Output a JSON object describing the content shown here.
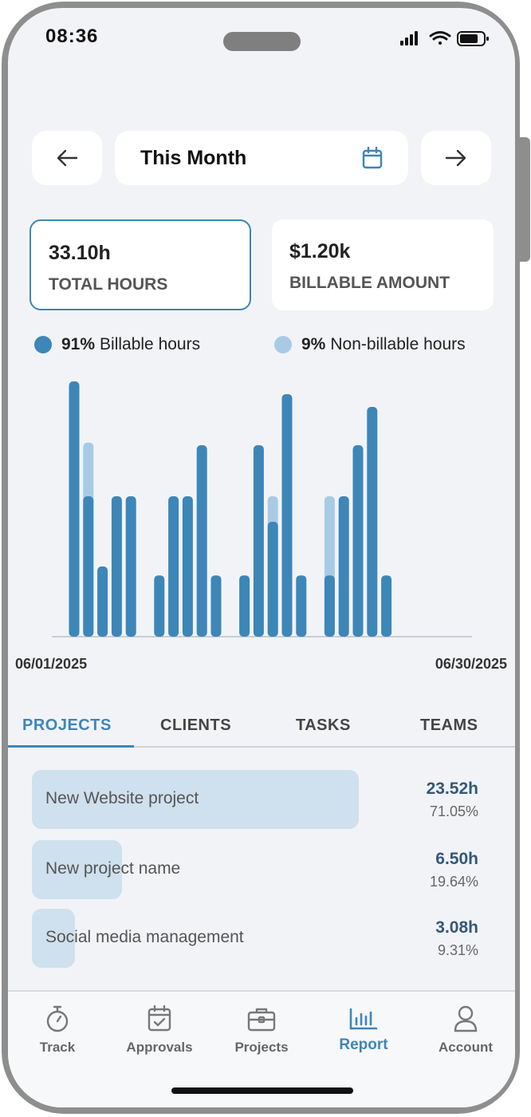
{
  "status_bar": {
    "time": "08:36"
  },
  "range_selector": {
    "label": "This Month"
  },
  "stats": [
    {
      "value": "33.10h",
      "label": "TOTAL HOURS",
      "selected": true
    },
    {
      "value": "$1.20k",
      "label": "BILLABLE AMOUNT",
      "selected": false
    }
  ],
  "legend": [
    {
      "percent": "91%",
      "label": "Billable hours",
      "color": "#3d86b8"
    },
    {
      "percent": "9%",
      "label": "Non-billable hours",
      "color": "#a8cbe5"
    }
  ],
  "chart_data": {
    "type": "bar",
    "stacked": true,
    "x_start_label": "06/01/2025",
    "x_end_label": "06/30/2025",
    "series": [
      {
        "name": "Billable hours",
        "color": "#3d86b8",
        "values": [
          2.0,
          1.1,
          0.55,
          1.1,
          1.1,
          0,
          0.48,
          1.1,
          1.1,
          1.5,
          0.48,
          0,
          0.48,
          1.5,
          0.9,
          1.9,
          0.48,
          0,
          0.48,
          1.1,
          1.5,
          1.8,
          0.48
        ]
      },
      {
        "name": "Non-billable hours",
        "color": "#a8cbe5",
        "values": [
          0,
          0.42,
          0,
          0,
          0,
          0,
          0,
          0,
          0,
          0,
          0,
          0,
          0,
          0,
          0.2,
          0,
          0,
          0,
          0.62,
          0,
          0,
          0,
          0
        ]
      }
    ],
    "ylim": [
      0,
      2.05
    ],
    "grid": false
  },
  "tabs": [
    {
      "label": "PROJECTS",
      "active": true
    },
    {
      "label": "CLIENTS",
      "active": false
    },
    {
      "label": "TASKS",
      "active": false
    },
    {
      "label": "TEAMS",
      "active": false
    }
  ],
  "projects": [
    {
      "name": "New Website project",
      "hours": "23.52h",
      "percent": "71.05%",
      "share": 0.7105
    },
    {
      "name": "New project name",
      "hours": "6.50h",
      "percent": "19.64%",
      "share": 0.1964
    },
    {
      "name": "Social media management",
      "hours": "3.08h",
      "percent": "9.31%",
      "share": 0.0931
    }
  ],
  "bottom_nav": [
    {
      "label": "Track",
      "icon": "stopwatch-icon",
      "active": false
    },
    {
      "label": "Approvals",
      "icon": "calendar-check-icon",
      "active": false
    },
    {
      "label": "Projects",
      "icon": "briefcase-icon",
      "active": false
    },
    {
      "label": "Report",
      "icon": "bar-chart-icon",
      "active": true
    },
    {
      "label": "Account",
      "icon": "user-icon",
      "active": false
    }
  ],
  "colors": {
    "accent": "#3d86b8",
    "accent_light": "#a8cbe5",
    "row_fill": "#cfe0ee"
  }
}
